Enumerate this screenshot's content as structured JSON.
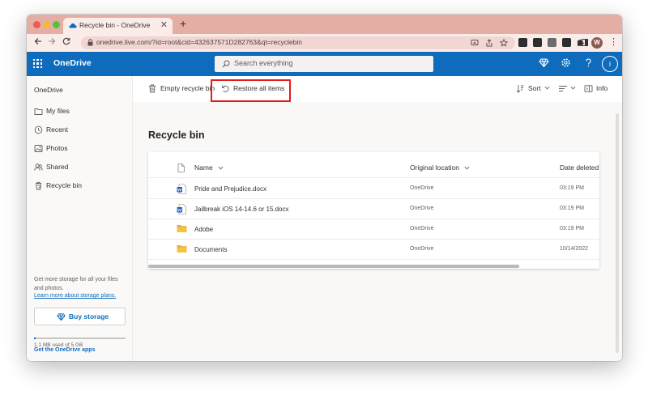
{
  "browser": {
    "tab_title": "Recycle bin - OneDrive",
    "new_tab_label": "+",
    "tab_close": "✕",
    "url": "onedrive.live.com/?id=root&cid=432637571D282763&qt=recyclebin",
    "profile_initial": "W"
  },
  "header": {
    "brand": "OneDrive",
    "search_placeholder": "Search everything",
    "account_initial": "i"
  },
  "sidebar": {
    "root_label": "OneDrive",
    "items": [
      {
        "label": "My files",
        "icon": "folder-icon"
      },
      {
        "label": "Recent",
        "icon": "clock-icon"
      },
      {
        "label": "Photos",
        "icon": "photo-icon"
      },
      {
        "label": "Shared",
        "icon": "people-icon"
      },
      {
        "label": "Recycle bin",
        "icon": "recycle-bin-icon"
      }
    ],
    "promo_text": "Get more storage for all your files and photos.",
    "promo_link": "Learn more about storage plans.",
    "buy_label": "Buy storage",
    "quota_text": "1.1 MB used of 5 GB",
    "quota_fraction": 0.02,
    "apps_link": "Get the OneDrive apps"
  },
  "commands": {
    "empty_label": "Empty recycle bin",
    "restore_label": "Restore all items",
    "sort_label": "Sort",
    "info_label": "Info"
  },
  "main": {
    "title": "Recycle bin",
    "columns": {
      "name": "Name",
      "location": "Original location",
      "date": "Date deleted"
    },
    "rows": [
      {
        "name": "Pride and Prejudice.docx",
        "type": "word",
        "location": "OneDrive",
        "date": "03:19 PM"
      },
      {
        "name": "Jailbreak iOS 14-14.6 or 15.docx",
        "type": "word",
        "location": "OneDrive",
        "date": "03:19 PM"
      },
      {
        "name": "Adobe",
        "type": "folder",
        "location": "OneDrive",
        "date": "03:19 PM"
      },
      {
        "name": "Documents",
        "type": "folder",
        "location": "OneDrive",
        "date": "10/14/2022"
      }
    ]
  },
  "colors": {
    "brand_blue": "#0f6cbd",
    "tab_strip": "#e5aea5",
    "highlight_red": "#e21c1c",
    "folder_yellow": "#f5c342"
  }
}
